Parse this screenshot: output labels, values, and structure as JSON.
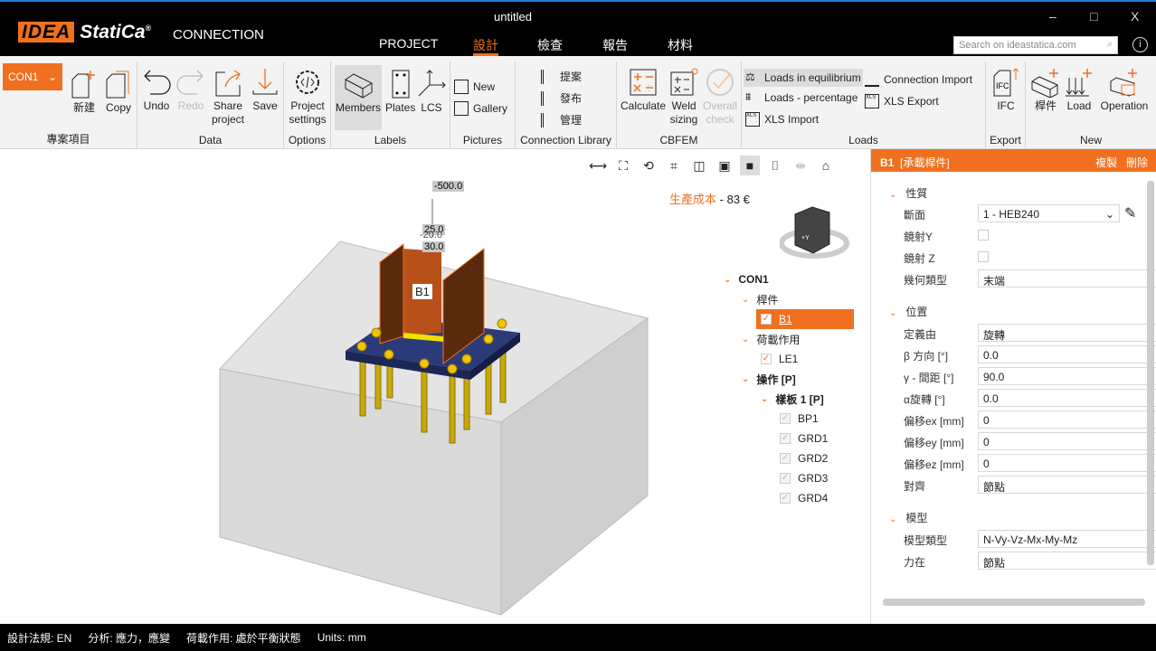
{
  "app": {
    "logo": "IDEA StatiCa",
    "logo_mark": "IDEA",
    "logo_word": "StatiCa®",
    "product": "CONNECTION",
    "title": "untitled",
    "search_placeholder": "Search on ideastatica.com",
    "info": "i",
    "nav": [
      "PROJECT",
      "設計",
      "檢查",
      "報告",
      "材料"
    ],
    "active_nav": "設計",
    "window": {
      "minimize": "–",
      "maximize": "□",
      "close": "X"
    }
  },
  "ribbon": {
    "connection": "CON1",
    "groups": {
      "project": "專案項目",
      "data": "Data",
      "options": "Options",
      "labels": "Labels",
      "pictures": "Pictures",
      "library": "Connection Library",
      "cbfem": "CBFEM",
      "loads": "Loads",
      "export": "Export",
      "new": "New"
    },
    "buttons": {
      "new": "新建",
      "copy": "Copy",
      "undo": "Undo",
      "redo": "Redo",
      "share": "Share project",
      "save": "Save",
      "settings": "Project settings",
      "members": "Members",
      "plates": "Plates",
      "lcs": "LCS",
      "pic_new": "New",
      "gallery": "Gallery",
      "propose": "提案",
      "publish": "發布",
      "manage": "管理",
      "calculate": "Calculate",
      "weld": "Weld sizing",
      "overall": "Overall check",
      "loads_eq": "Loads in equilibrium",
      "loads_pct": "Loads - percentage",
      "xls_import": "XLS Import",
      "conn_import": "Connection Import",
      "xls_export": "XLS Export",
      "ifc": "IFC",
      "member": "桿件",
      "load": "Load",
      "operation": "Operation"
    }
  },
  "viewport": {
    "cost_label": "生產成本",
    "cost_sep": "-",
    "cost_value": "83 €",
    "member_label": "B1",
    "dims": [
      "-500.0",
      "25.0",
      "-20.0",
      "30.0"
    ],
    "cube_face": "+Y"
  },
  "tree": {
    "root": "CON1",
    "members": "桿件",
    "b1": "B1",
    "load_effects": "荷載作用",
    "le1": "LE1",
    "operations": "操作 [P]",
    "base_plate": "樣板 1 [P]",
    "items": [
      "BP1",
      "GRD1",
      "GRD2",
      "GRD3",
      "GRD4"
    ]
  },
  "panel": {
    "title": "B1",
    "subtitle": "[承載桿件]",
    "copy": "複製",
    "delete": "刪除",
    "sections": {
      "props": "性質",
      "position": "位置",
      "model": "模型"
    },
    "props": {
      "section_label": "斷面",
      "section_value": "1 - HEB240",
      "mirror_y": "鏡射Y",
      "mirror_z": "鏡射 Z",
      "geom_label": "幾何類型",
      "geom_value": "末端"
    },
    "position": {
      "def_label": "定義由",
      "def_value": "旋轉",
      "beta_label": "β 方向 [°]",
      "beta_value": "0.0",
      "gamma_label": "γ - 間距 [°]",
      "gamma_value": "90.0",
      "alpha_label": "α旋轉 [°]",
      "alpha_value": "0.0",
      "ex_label": "偏移ex [mm]",
      "ex_value": "0",
      "ey_label": "偏移ey [mm]",
      "ey_value": "0",
      "ez_label": "偏移ez [mm]",
      "ez_value": "0",
      "align_label": "對齊",
      "align_value": "節點"
    },
    "model": {
      "type_label": "模型類型",
      "type_value": "N-Vy-Vz-Mx-My-Mz",
      "force_label": "力在",
      "force_value": "節點"
    }
  },
  "status": {
    "code": "設計法規: EN",
    "analysis": "分析: 應力，應變",
    "loads": "荷載作用: 處於平衡狀態",
    "units": "Units: mm"
  },
  "colors": {
    "accent": "#f07020",
    "titlebar": "#000000",
    "ribbon": "#f3f3f3",
    "plate": "#2b3a78",
    "bolt": "#f0c400",
    "member": "#b8501a"
  }
}
